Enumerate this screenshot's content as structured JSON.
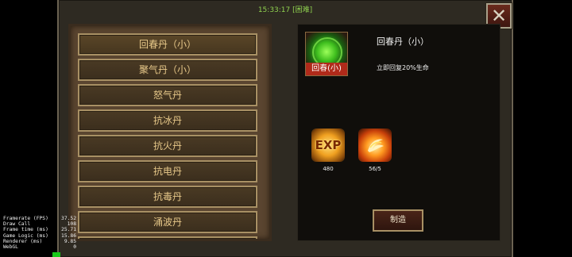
{
  "header": {
    "time": "15:33:17",
    "difficulty": "[困难]"
  },
  "close_button": {
    "glyph": "✕"
  },
  "recipe_list": {
    "items": [
      {
        "label": "回春丹（小）"
      },
      {
        "label": "聚气丹（小）"
      },
      {
        "label": "怒气丹"
      },
      {
        "label": "抗冰丹"
      },
      {
        "label": "抗火丹"
      },
      {
        "label": "抗电丹"
      },
      {
        "label": "抗毒丹"
      },
      {
        "label": "涌波丹"
      },
      {
        "label": ""
      }
    ],
    "selected_index": 0
  },
  "detail": {
    "icon_caption": "回春(小)",
    "title": "回春丹（小）",
    "description": "立即回复20%生命",
    "materials": [
      {
        "icon": "exp-icon",
        "icon_text": "EXP",
        "count": "480"
      },
      {
        "icon": "fire-material-icon",
        "icon_text": "",
        "count": "56/5"
      }
    ],
    "craft_label": "制造"
  },
  "stats": [
    {
      "label": "Framerate (FPS)",
      "value": "37.52"
    },
    {
      "label": "Draw Call",
      "value": "108"
    },
    {
      "label": "Frame time (ms)",
      "value": "25.71"
    },
    {
      "label": "Game Logic (ms)",
      "value": "15.86"
    },
    {
      "label": "Renderer (ms)",
      "value": "9.85"
    },
    {
      "label": "WebGL",
      "value": "0"
    }
  ],
  "colors": {
    "header_text": "#8fd14f",
    "list_text": "#e8c98a",
    "panel_bg": "#100e0b"
  }
}
